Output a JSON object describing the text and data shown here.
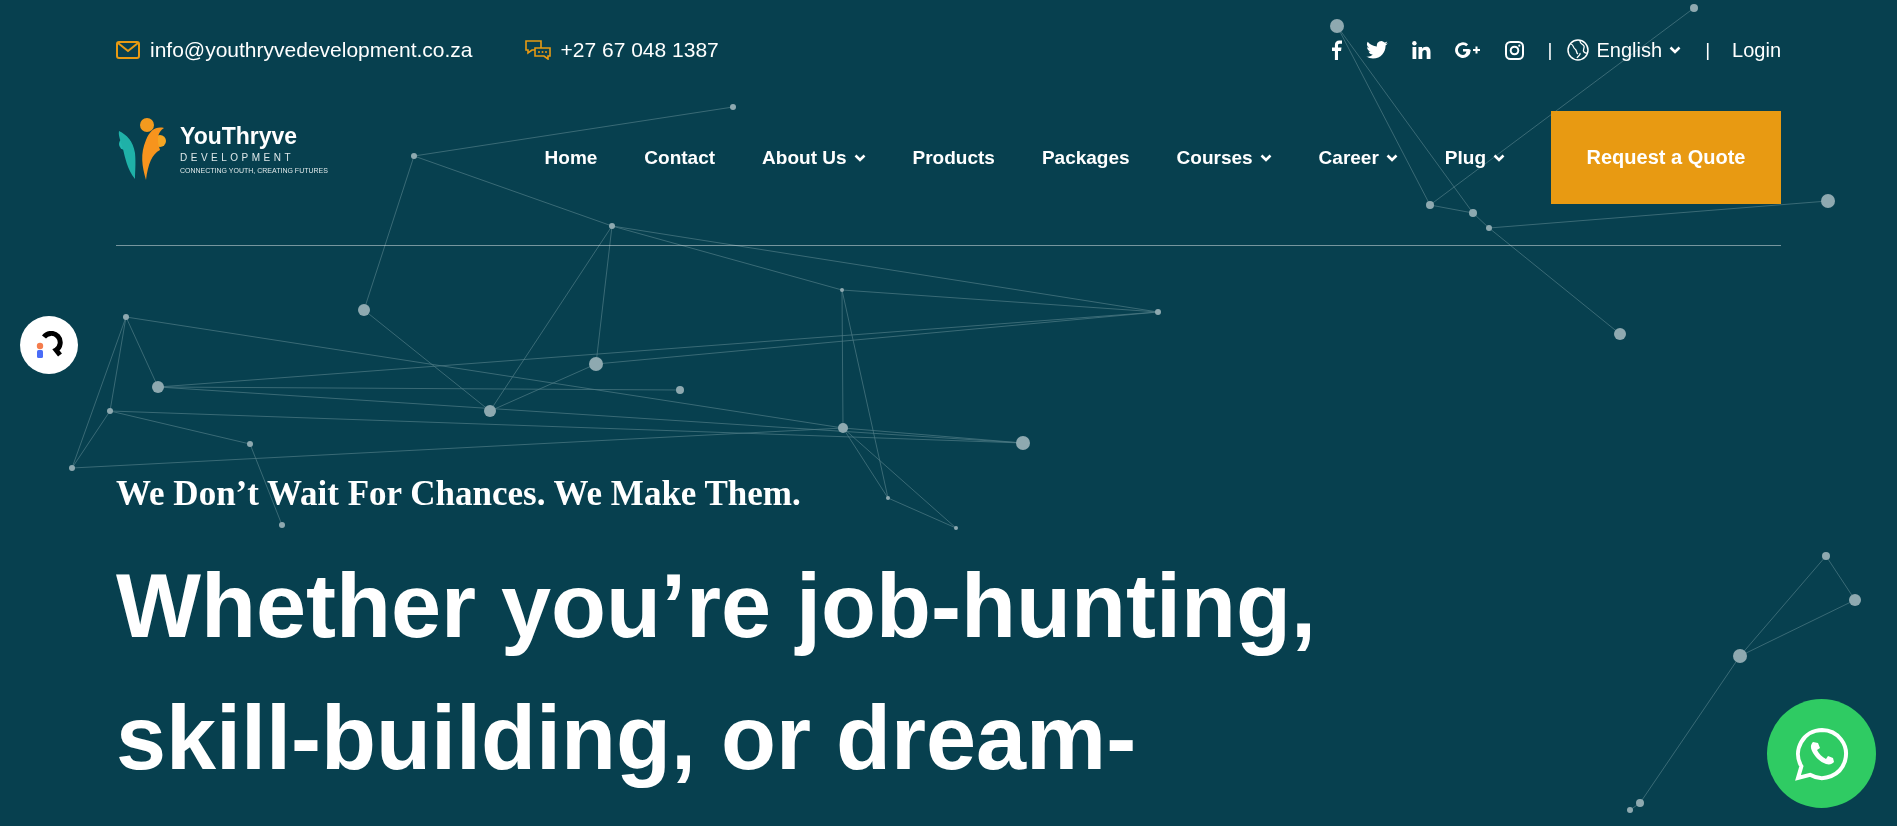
{
  "topbar": {
    "email": "info@youthryvedevelopment.co.za",
    "phone": "+27 67 048 1387",
    "separator_1": "|",
    "language": "English",
    "separator_2": "|",
    "login": "Login"
  },
  "logo": {
    "name": "YouThryve",
    "subtitle": "DEVELOPMENT",
    "tagline": "CONNECTING YOUTH, CREATING FUTURES"
  },
  "nav": [
    {
      "label": "Home",
      "dropdown": false
    },
    {
      "label": "Contact",
      "dropdown": false
    },
    {
      "label": "About Us",
      "dropdown": true
    },
    {
      "label": "Products",
      "dropdown": false
    },
    {
      "label": "Packages",
      "dropdown": false
    },
    {
      "label": "Courses",
      "dropdown": true
    },
    {
      "label": "Career",
      "dropdown": true
    },
    {
      "label": "Plug",
      "dropdown": true
    }
  ],
  "cta": "Request a Quote",
  "hero": {
    "tagline": "We Don’t Wait For Chances. We Make Them.",
    "headline_lines": [
      "Whether you’re job-hunting,",
      "skill-building, or dream-"
    ]
  }
}
